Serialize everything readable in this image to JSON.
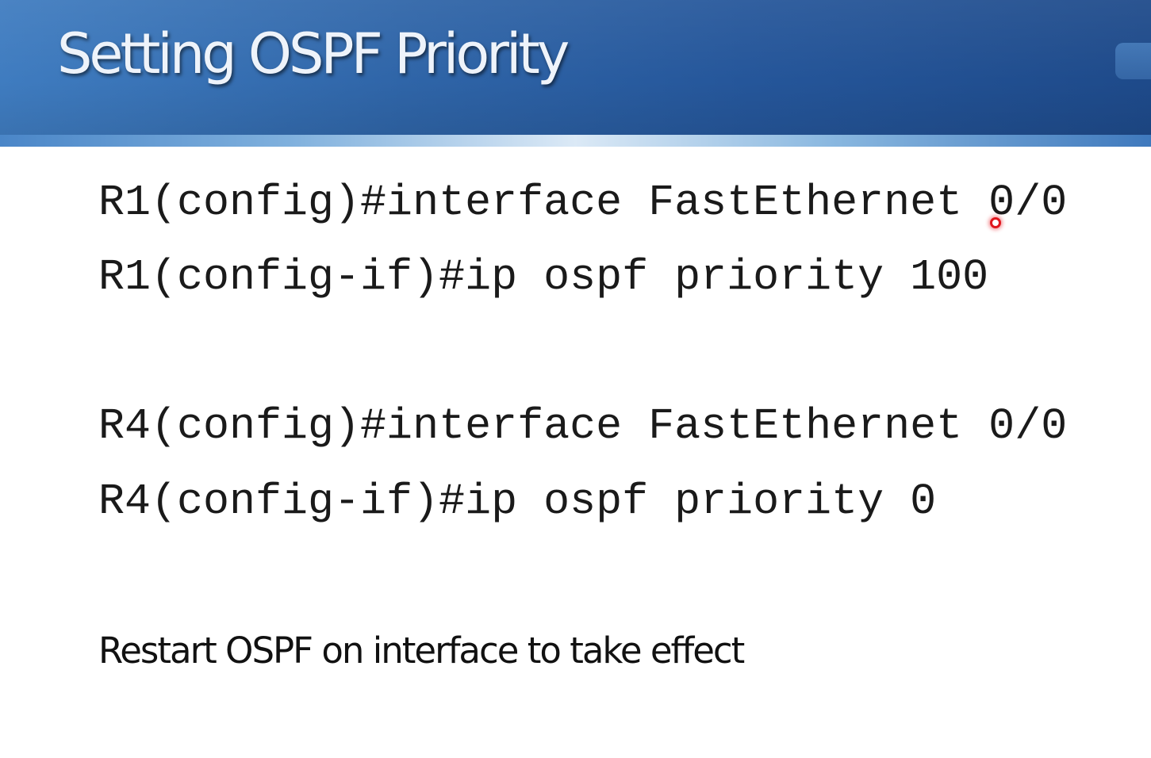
{
  "slide": {
    "title": "Setting OSPF Priority",
    "code_lines": [
      "R1(config)#interface FastEthernet 0/0",
      "R1(config-if)#ip ospf priority 100",
      "R4(config)#interface FastEthernet 0/0",
      "R4(config-if)#ip ospf priority 0"
    ],
    "note": "Restart OSPF on interface to take effect"
  },
  "colors": {
    "title_bar": "#2f65a8",
    "title_text": "#eef3fa",
    "body_text": "#1a1a1a",
    "pointer": "#e0161d"
  },
  "icons": {
    "pointer": "laser-pointer-icon"
  }
}
